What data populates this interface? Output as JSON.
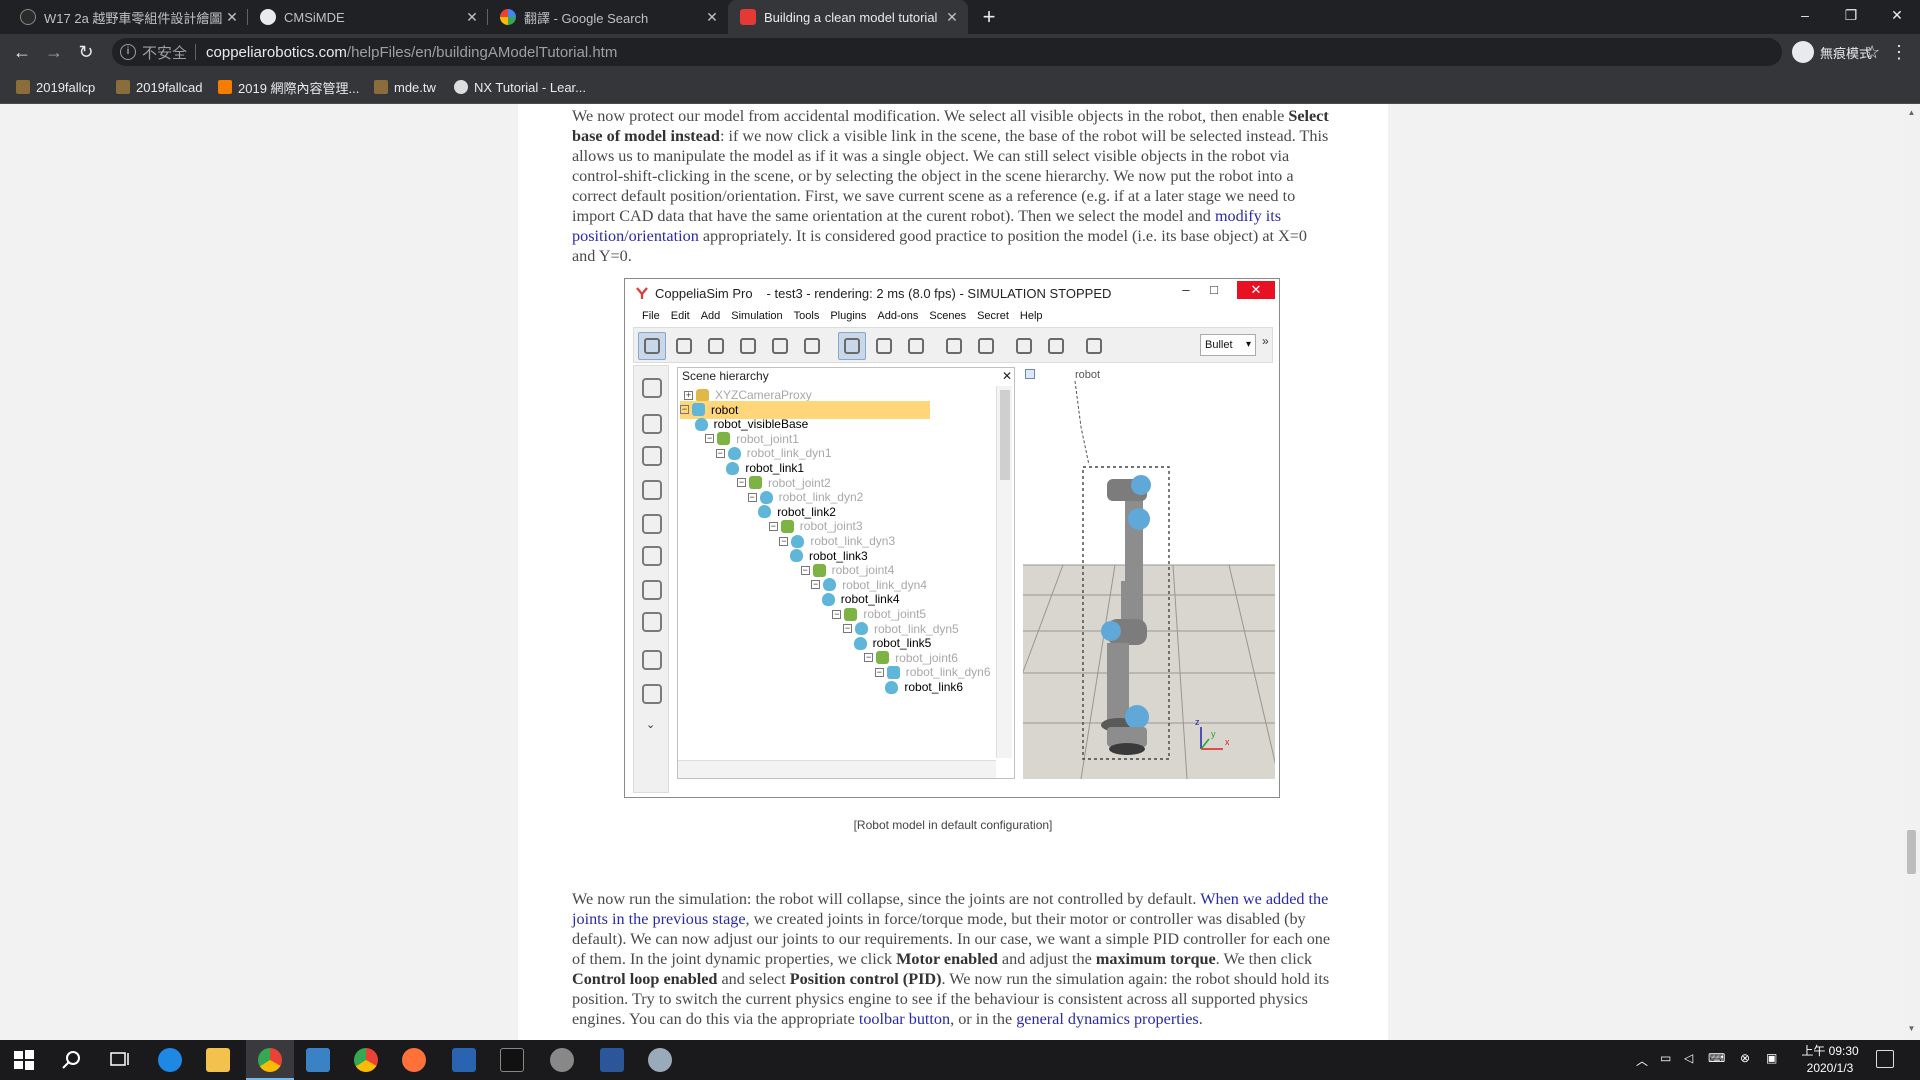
{
  "tabs": [
    {
      "title": "W17 2a 越野車零組件設計繪圖",
      "color": "#2b2b2b"
    },
    {
      "title": "CMSiMDE",
      "color": "#e8eaed"
    },
    {
      "title": "翻譯 - Google Search",
      "color": "#4285f4"
    },
    {
      "title": "Building a clean model tutorial",
      "color": "#e53935"
    }
  ],
  "window_controls": {
    "minimize": "–",
    "maximize": "❐",
    "close": "✕"
  },
  "toolbar": {
    "security_label": "不安全",
    "url_host": "coppeliarobotics.com",
    "url_path": "/helpFiles/en/buildingAModelTutorial.htm",
    "incognito_label": "無痕模式"
  },
  "bookmarks": [
    {
      "label": "2019fallcp",
      "color": "#8a6d3b"
    },
    {
      "label": "2019fallcad",
      "color": "#8a6d3b"
    },
    {
      "label": "2019 網際內容管理...",
      "color": "#f57c00"
    },
    {
      "label": "mde.tw",
      "color": "#8a6d3b"
    },
    {
      "label": "NX Tutorial - Lear...",
      "color": "#dddddd"
    }
  ],
  "page": {
    "p1": {
      "t1": "We now protect our model from accidental modification. We select all visible objects in the robot, then enable ",
      "b1": "Select base of model instead",
      "t2": ": if we now click a visible link in the scene, the base of the robot will be selected instead. This allows us to manipulate the model as if it was a single object. We can still select visible objects in the robot via control-shift-clicking in the scene, or by selecting the object in the scene hierarchy. We now put the robot into a correct default position/orientation. First, we save current scene as a reference (e.g. if at a later stage we need to import CAD data that have the same orientation at the curent robot). Then we select the model and ",
      "link1": "modify its position/orientation",
      "t3": " appropriately. It is considered good practice to position the model (i.e. its base object) at X=0 and Y=0."
    },
    "caption": "[Robot model in default configuration]",
    "p2": {
      "t1": "We now run the simulation: the robot will collapse, since the joints are not controlled by default. ",
      "link1": "When we added the joints in the previous stage",
      "t2": ", we created joints in force/torque mode, but their motor or controller was disabled (by default). We can now adjust our joints to our requirements. In our case, we want a simple PID controller for each one of them. In the joint dynamic properties, we click ",
      "b1": "Motor enabled",
      "t3": " and adjust the ",
      "b2": "maximum torque",
      "t4": ". We then click ",
      "b3": "Control loop enabled",
      "t5": " and select ",
      "b4": "Position control (PID)",
      "t6": ". We now run the simulation again: the robot should hold its position. Try to switch the current physics engine to see if the behaviour is consistent across all supported physics engines. You can do this via the appropriate ",
      "link2": "toolbar button",
      "t7": ", or in the ",
      "link3": "general dynamics properties",
      "t8": "."
    }
  },
  "figure": {
    "app_name": "CoppeliaSim Pro",
    "title_rest": "- test3 - rendering: 2 ms (8.0 fps) - SIMULATION STOPPED",
    "menu": [
      "File",
      "Edit",
      "Add",
      "Simulation",
      "Tools",
      "Plugins",
      "Add-ons",
      "Scenes",
      "Secret",
      "Help"
    ],
    "engine": "Bullet",
    "more": "»",
    "hierarchy_title": "Scene hierarchy",
    "hierarchy_close": "✕",
    "nodes": [
      {
        "label": "XYZCameraProxy",
        "type": "camera",
        "state": "dim"
      },
      {
        "label": "robot",
        "type": "model",
        "state": "selected"
      },
      {
        "label": "robot_visibleBase",
        "type": "shape",
        "state": "normal"
      },
      {
        "label": "robot_joint1",
        "type": "joint",
        "state": "dim"
      },
      {
        "label": "robot_link_dyn1",
        "type": "shape",
        "state": "dim"
      },
      {
        "label": "robot_link1",
        "type": "shape",
        "state": "normal"
      },
      {
        "label": "robot_joint2",
        "type": "joint",
        "state": "dim"
      },
      {
        "label": "robot_link_dyn2",
        "type": "shape",
        "state": "dim"
      },
      {
        "label": "robot_link2",
        "type": "shape",
        "state": "normal"
      },
      {
        "label": "robot_joint3",
        "type": "joint",
        "state": "dim"
      },
      {
        "label": "robot_link_dyn3",
        "type": "shape",
        "state": "dim"
      },
      {
        "label": "robot_link3",
        "type": "shape",
        "state": "normal"
      },
      {
        "label": "robot_joint4",
        "type": "joint",
        "state": "dim"
      },
      {
        "label": "robot_link_dyn4",
        "type": "shape",
        "state": "dim"
      },
      {
        "label": "robot_link4",
        "type": "shape",
        "state": "normal"
      },
      {
        "label": "robot_joint5",
        "type": "joint",
        "state": "dim"
      },
      {
        "label": "robot_link_dyn5",
        "type": "shape",
        "state": "dim"
      },
      {
        "label": "robot_link5",
        "type": "shape",
        "state": "normal"
      },
      {
        "label": "robot_joint6",
        "type": "joint",
        "state": "dim"
      },
      {
        "label": "robot_link_dyn6",
        "type": "model",
        "state": "dim"
      },
      {
        "label": "robot_link6",
        "type": "shape",
        "state": "normal"
      }
    ],
    "scene_label": "robot",
    "axis_labels": {
      "x": "x",
      "y": "y",
      "z": "z"
    }
  },
  "taskbar": {
    "clock_time": "上午 09:30",
    "clock_date": "2020/1/3"
  },
  "colors": {
    "link": "#2a2aa8",
    "selection": "#ffd67a",
    "chrome_dark": "#202124",
    "chrome_mid": "#35363a"
  }
}
